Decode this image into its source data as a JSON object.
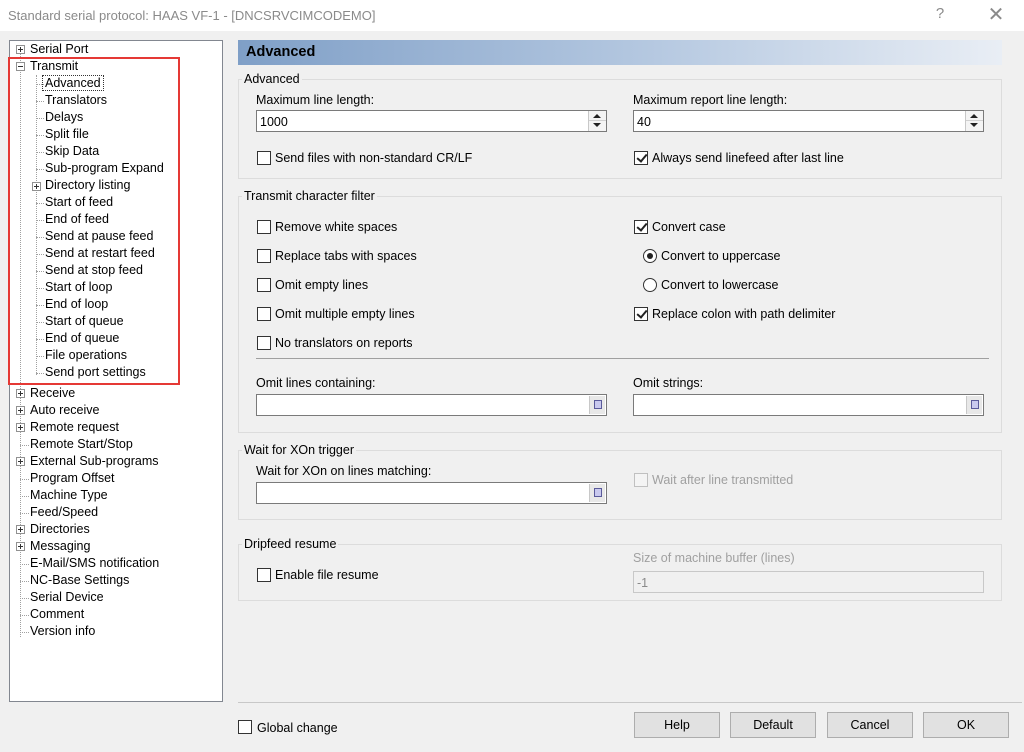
{
  "window": {
    "title": "Standard serial protocol: HAAS VF-1 - [DNCSRVCIMCODEMO]",
    "help_glyph": "?",
    "close_glyph": "✕"
  },
  "tree": {
    "items": [
      {
        "label": "Serial Port"
      },
      {
        "label": "Transmit"
      },
      {
        "label": "Advanced"
      },
      {
        "label": "Translators"
      },
      {
        "label": "Delays"
      },
      {
        "label": "Split file"
      },
      {
        "label": "Skip Data"
      },
      {
        "label": "Sub-program Expand"
      },
      {
        "label": "Directory listing"
      },
      {
        "label": "Start of feed"
      },
      {
        "label": "End of feed"
      },
      {
        "label": "Send at pause feed"
      },
      {
        "label": "Send at restart feed"
      },
      {
        "label": "Send at stop feed"
      },
      {
        "label": "Start of loop"
      },
      {
        "label": "End of loop"
      },
      {
        "label": "Start of queue"
      },
      {
        "label": "End of queue"
      },
      {
        "label": "File operations"
      },
      {
        "label": "Send port settings"
      },
      {
        "label": "Receive"
      },
      {
        "label": "Auto receive"
      },
      {
        "label": "Remote request"
      },
      {
        "label": "Remote Start/Stop"
      },
      {
        "label": "External Sub-programs"
      },
      {
        "label": "Program Offset"
      },
      {
        "label": "Machine Type"
      },
      {
        "label": "Feed/Speed"
      },
      {
        "label": "Directories"
      },
      {
        "label": "Messaging"
      },
      {
        "label": "E-Mail/SMS notification"
      },
      {
        "label": "NC-Base Settings"
      },
      {
        "label": "Serial Device"
      },
      {
        "label": "Comment"
      },
      {
        "label": "Version info"
      }
    ],
    "highlight_color": "#e53935"
  },
  "panel": {
    "title": "Advanced",
    "header_color": "#7f9fc7"
  },
  "advanced": {
    "group_label": "Advanced",
    "max_line_label": "Maximum line length:",
    "max_line_value": "1000",
    "max_report_label": "Maximum report line length:",
    "max_report_value": "40",
    "nonstandard_crlf_label": "Send files with non-standard CR/LF",
    "nonstandard_crlf_checked": false,
    "linefeed_label": "Always send linefeed after last line",
    "linefeed_checked": true
  },
  "filter": {
    "group_label": "Transmit character filter",
    "remove_white_label": "Remove white spaces",
    "replace_tabs_label": "Replace tabs with spaces",
    "omit_empty_label": "Omit empty lines",
    "omit_multiple_label": "Omit multiple empty lines",
    "no_translators_label": "No translators on reports",
    "convert_case_label": "Convert case",
    "convert_case_checked": true,
    "uppercase_label": "Convert to uppercase",
    "uppercase_selected": true,
    "lowercase_label": "Convert to lowercase",
    "replace_colon_label": "Replace colon with path delimiter",
    "replace_colon_checked": true,
    "omit_lines_label": "Omit lines containing:",
    "omit_lines_value": "",
    "omit_strings_label": "Omit strings:",
    "omit_strings_value": ""
  },
  "xon": {
    "group_label": "Wait for XOn trigger",
    "matching_label": "Wait for XOn on lines matching:",
    "matching_value": "",
    "wait_after_label": "Wait after line transmitted",
    "wait_after_enabled": false
  },
  "dripfeed": {
    "group_label": "Dripfeed resume",
    "enable_label": "Enable file resume",
    "enable_checked": false,
    "buffer_label": "Size of machine buffer (lines)",
    "buffer_value": "-1"
  },
  "footer": {
    "global_change_label": "Global change",
    "help_label": "Help",
    "default_label": "Default",
    "cancel_label": "Cancel",
    "ok_label": "OK"
  }
}
